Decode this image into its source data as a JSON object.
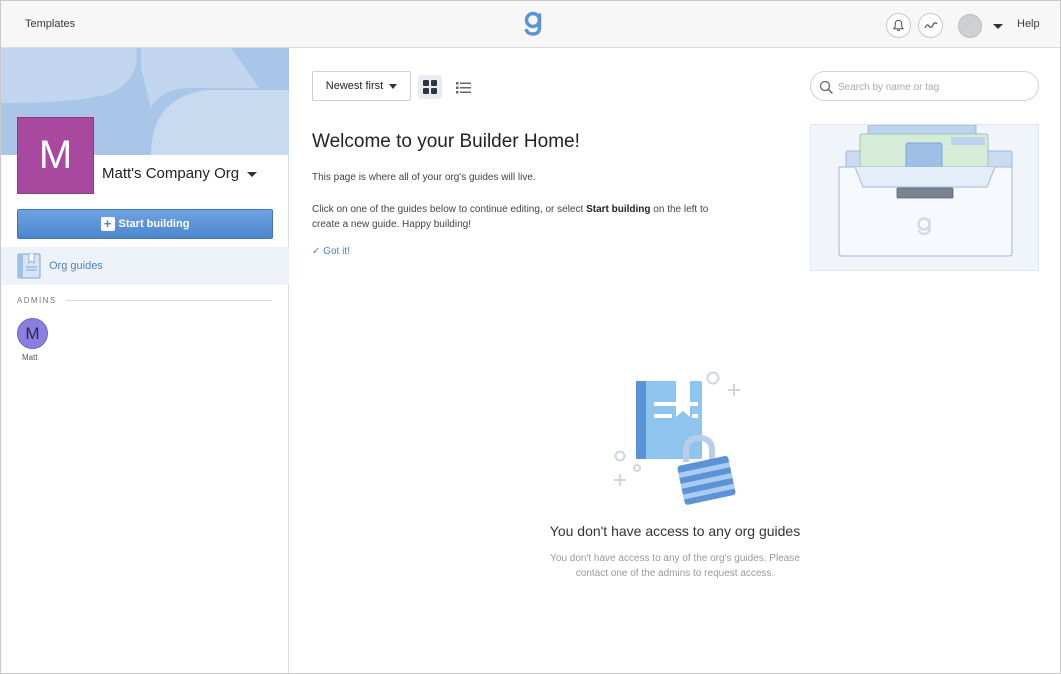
{
  "topbar": {
    "templates_label": "Templates",
    "help_label": "Help"
  },
  "sidebar": {
    "org_initial": "M",
    "org_name": "Matt's Company Org",
    "start_building_label": "Start building",
    "org_guides_label": "Org guides",
    "admins_heading": "ADMINS",
    "admins": [
      {
        "initial": "M",
        "name": "Matt"
      }
    ]
  },
  "main": {
    "sort_label": "Newest first",
    "search_placeholder": "Search by name or tag",
    "welcome_title": "Welcome to your Builder Home!",
    "welcome_line1": "This page is where all of your org's guides will live.",
    "welcome_line2_pre": "Click on one of the guides below to continue editing, or select ",
    "welcome_line2_bold": "Start building",
    "welcome_line2_post": " on the left to create a new guide. Happy building!",
    "got_it_label": "Got it!",
    "empty_title": "You don't have access to any org guides",
    "empty_desc_line1": "You don't have access to any of the org's guides. Please",
    "empty_desc_line2": "contact one of the admins to request access."
  },
  "colors": {
    "accent": "#4a82c6",
    "org_tile": "#a8489f",
    "admin_avatar": "#8a7ee0",
    "banner": "#a9c6e8"
  },
  "icons": [
    "g-logo-icon",
    "bell-icon",
    "activity-icon",
    "user-avatar",
    "caret-down-icon",
    "plus-icon",
    "book-icon",
    "grid-view-icon",
    "list-view-icon",
    "search-icon",
    "check-icon",
    "locked-book-icon",
    "folder-illustration"
  ]
}
